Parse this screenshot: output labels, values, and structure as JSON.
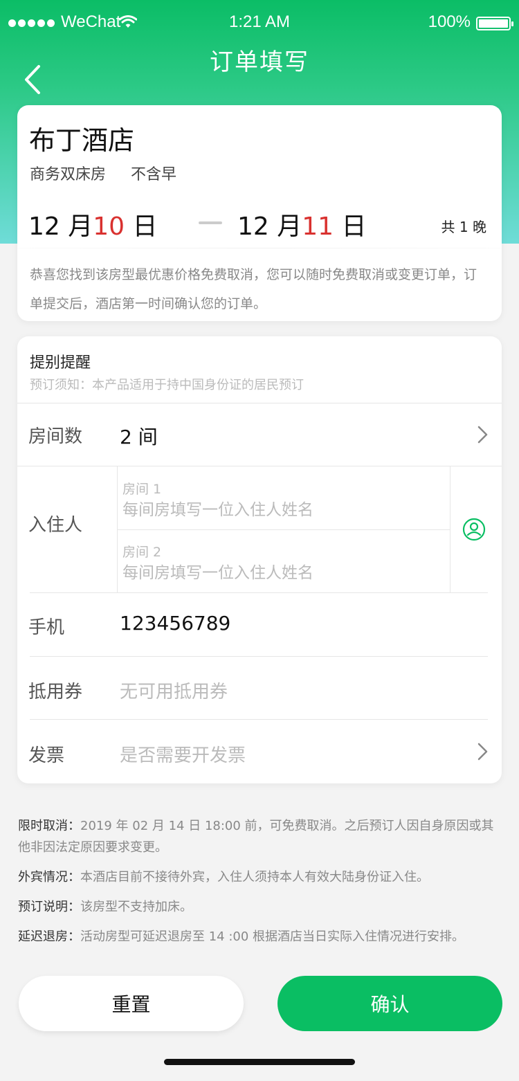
{
  "status_bar": {
    "carrier": "WeChat",
    "time": "1:21 AM",
    "battery": "100%"
  },
  "nav": {
    "title": "订单填写"
  },
  "hotel": {
    "name": "布丁酒店",
    "room_type": "商务双床房",
    "breakfast": "不含早",
    "checkin": {
      "month": "12",
      "month_unit": "月",
      "day": "10",
      "day_unit": "日"
    },
    "checkout": {
      "month": "12",
      "month_unit": "月",
      "day": "11",
      "day_unit": "日"
    },
    "nights": "共 1 晚",
    "promo": "恭喜您找到该房型最优惠价格免费取消，您可以随时免费取消或变更订单，订单提交后，酒店第一时间确认您的订单。"
  },
  "form": {
    "notice_title": "提别提醒",
    "notice_sub": "预订须知：本产品适用于持中国身份证的居民预订",
    "rooms": {
      "label": "房间数",
      "value": "2 间"
    },
    "guests": {
      "label": "入住人",
      "slots": [
        {
          "label": "房间 1",
          "placeholder": "每间房填写一位入住人姓名"
        },
        {
          "label": "房间 2",
          "placeholder": "每间房填写一位入住人姓名"
        }
      ]
    },
    "phone": {
      "label": "手机",
      "value": "123456789"
    },
    "coupon": {
      "label": "抵用券",
      "placeholder": "无可用抵用券"
    },
    "invoice": {
      "label": "发票",
      "placeholder": "是否需要开发票"
    }
  },
  "policies": [
    {
      "key": "限时取消：",
      "text": "2019 年 02 月 14 日 18:00 前，可免费取消。之后预订人因自身原因或其他非因法定原因要求变更。"
    },
    {
      "key": "外宾情况：",
      "text": "本酒店目前不接待外宾，入住人须持本人有效大陆身份证入住。"
    },
    {
      "key": "预订说明：",
      "text": "该房型不支持加床。"
    },
    {
      "key": "延迟退房：",
      "text": "活动房型可延迟退房至 14 :00 根据酒店当日实际入住情况进行安排。"
    }
  ],
  "buttons": {
    "reset": "重置",
    "confirm": "确认"
  },
  "colors": {
    "primary": "#0abe63",
    "highlight_day": "#d9312f"
  }
}
